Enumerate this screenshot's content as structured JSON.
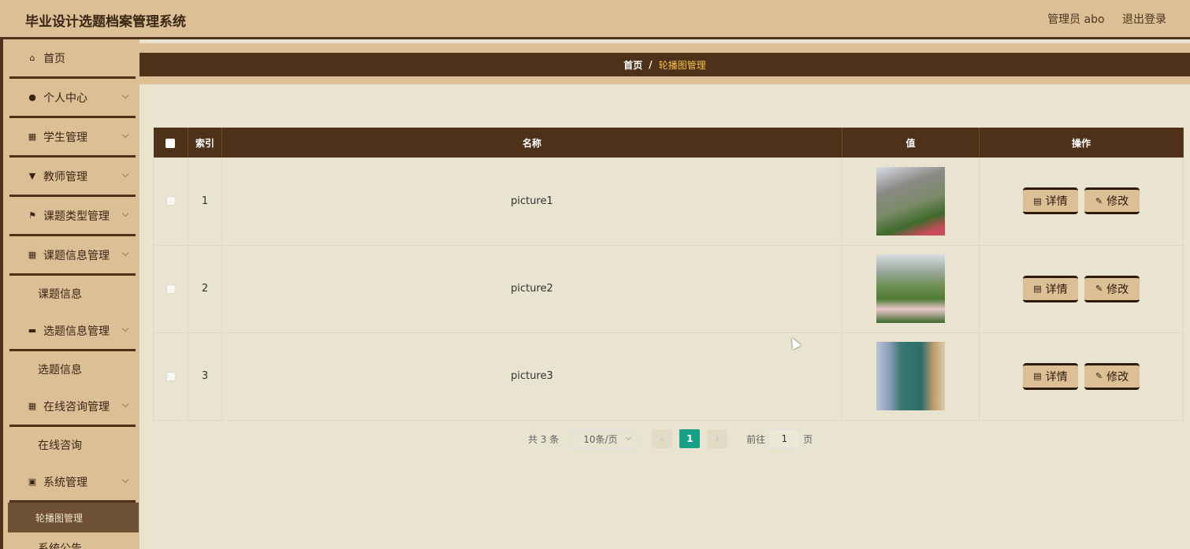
{
  "header": {
    "title": "毕业设计选题档案管理系统",
    "user": "管理员 abo",
    "logout": "退出登录"
  },
  "sidebar": {
    "items": [
      {
        "label": "首页",
        "icon": "home-icon",
        "glyph": "⌂"
      },
      {
        "label": "个人中心",
        "icon": "user-icon",
        "glyph": "●"
      },
      {
        "label": "学生管理",
        "icon": "grid-icon",
        "glyph": "▦"
      },
      {
        "label": "教师管理",
        "icon": "teacher-icon",
        "glyph": "▼"
      },
      {
        "label": "课题类型管理",
        "icon": "flag-icon",
        "glyph": "⚑"
      },
      {
        "label": "课题信息管理",
        "icon": "grid-icon",
        "glyph": "▦"
      },
      {
        "label": "课题信息"
      },
      {
        "label": "选题信息管理",
        "icon": "briefcase-icon",
        "glyph": "▬"
      },
      {
        "label": "选题信息"
      },
      {
        "label": "在线咨询管理",
        "icon": "grid-icon",
        "glyph": "▦"
      },
      {
        "label": "在线咨询"
      },
      {
        "label": "系统管理",
        "icon": "clipboard-icon",
        "glyph": "▣"
      },
      {
        "label": "轮播图管理"
      },
      {
        "label": "系统公告"
      }
    ]
  },
  "breadcrumb": {
    "home": "首页",
    "separator": "/",
    "current": "轮播图管理"
  },
  "table": {
    "headers": [
      "索引",
      "名称",
      "值",
      "操作"
    ],
    "rows": [
      {
        "index": "1",
        "name": "picture1"
      },
      {
        "index": "2",
        "name": "picture2"
      },
      {
        "index": "3",
        "name": "picture3"
      }
    ],
    "detail_label": "详情",
    "edit_label": "修改"
  },
  "pagination": {
    "total": "共 3 条",
    "page_size": "10条/页",
    "current_page": "1",
    "goto_prefix": "前往",
    "goto_value": "1",
    "goto_suffix": "页"
  },
  "colors": {
    "header_bg": "#dcbf95",
    "dark_brown": "#4e3119",
    "content_bg": "#e8e4d0",
    "accent_page": "#16a085",
    "breadcrumb_current": "#f5c04c"
  }
}
